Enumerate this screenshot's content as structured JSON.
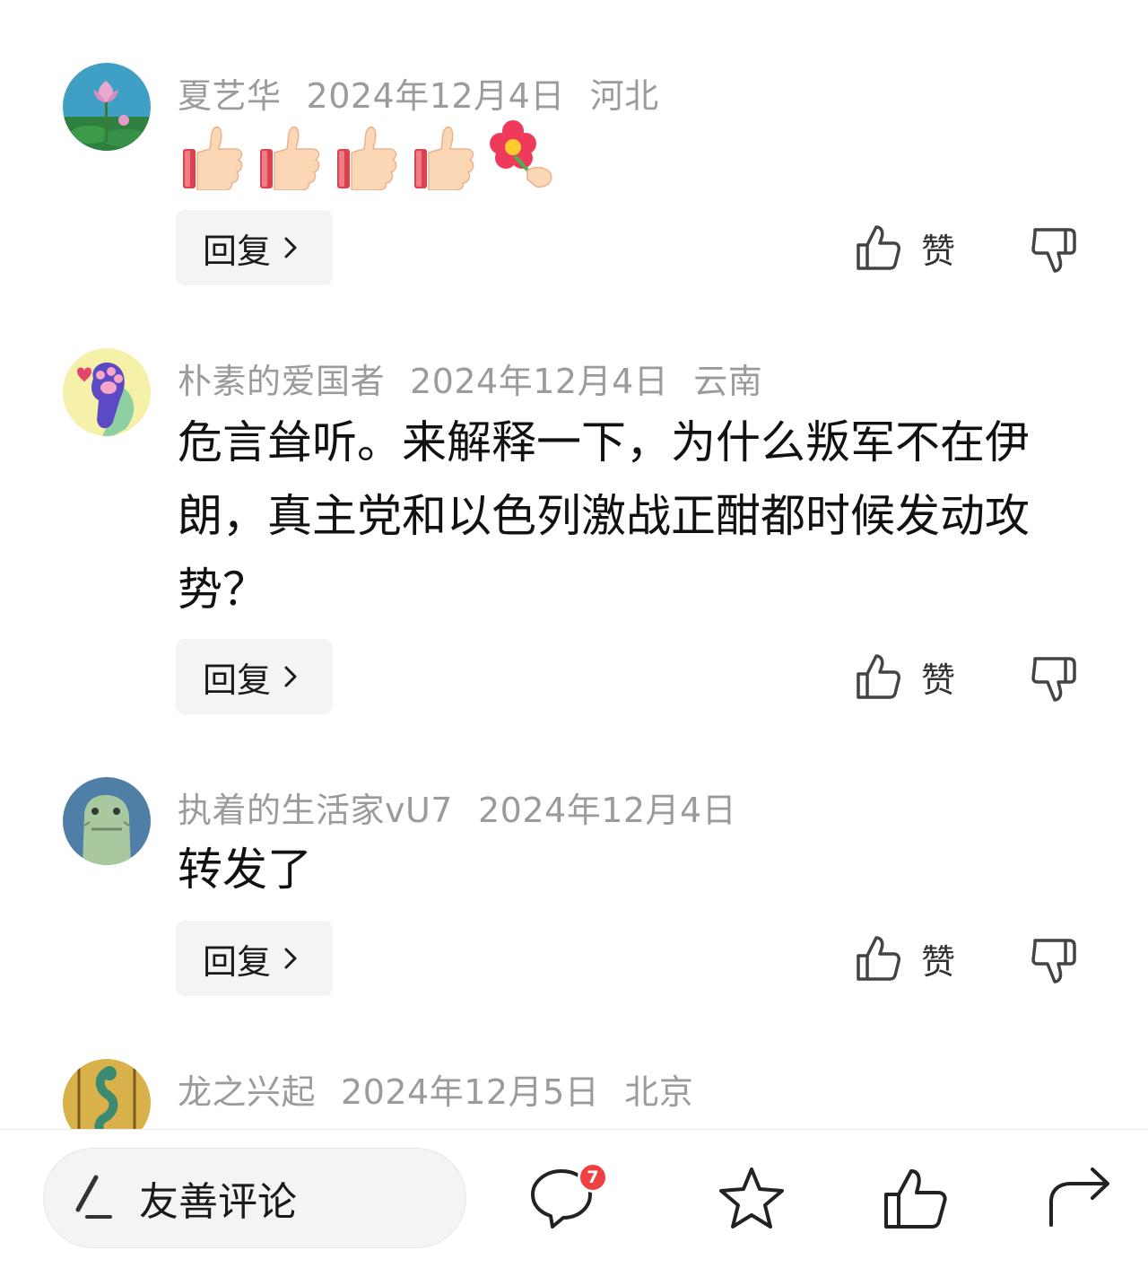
{
  "comments": [
    {
      "username": "夏艺华",
      "date": "2024年12月4日",
      "location": "河北",
      "text": "",
      "emojis": [
        "thumbs-up-emoji",
        "thumbs-up-emoji",
        "thumbs-up-emoji",
        "thumbs-up-emoji",
        "flower-emoji"
      ],
      "reply_label": "回复",
      "like_label": "赞"
    },
    {
      "username": "朴素的爱国者",
      "date": "2024年12月4日",
      "location": "云南",
      "text": "危言耸听。来解释一下，为什么叛军不在伊朗，真主党和以色列激战正酣都时候发动攻势？",
      "reply_label": "回复",
      "like_label": "赞"
    },
    {
      "username": "执着的生活家vU7",
      "date": "2024年12月4日",
      "location": "",
      "text": "转发了",
      "reply_label": "回复",
      "like_label": "赞"
    },
    {
      "username": "龙之兴起",
      "date": "2024年12月5日",
      "location": "北京",
      "text": ""
    }
  ],
  "bottom_bar": {
    "input_placeholder": "友善评论",
    "comment_badge": "7",
    "icons": [
      "pen-icon",
      "comment-icon",
      "star-icon",
      "thumbs-up-icon",
      "share-icon"
    ]
  },
  "colors": {
    "meta_text": "#9b9b9b",
    "body_text": "#111111",
    "badge": "#f04142",
    "reply_bg": "#f4f4f4"
  }
}
